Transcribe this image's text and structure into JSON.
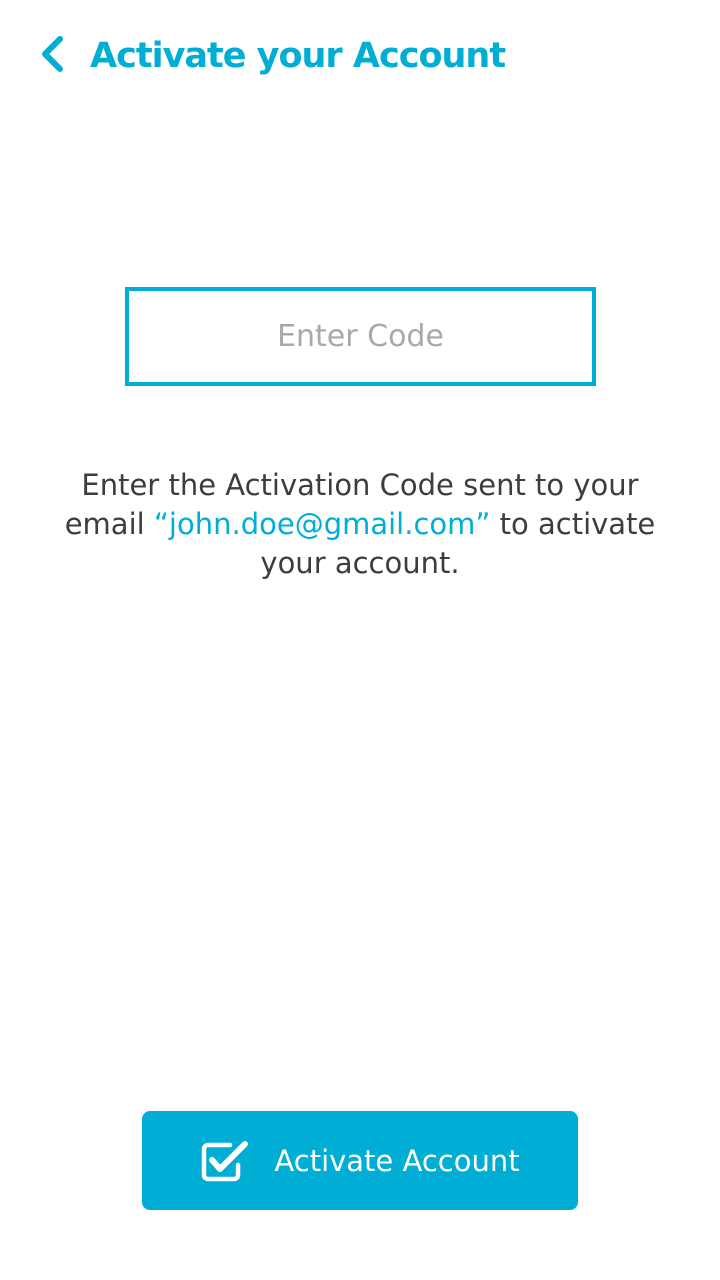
{
  "header": {
    "title": "Activate your Account",
    "back_icon": "chevron-left-icon"
  },
  "code_input": {
    "placeholder": "Enter Code",
    "value": ""
  },
  "instructions": {
    "before_email": "Enter the Activation Code sent to your email ",
    "email": "“john.doe@gmail.com”",
    "after_email": " to activate your account."
  },
  "activate_button": {
    "label": "Activate Account",
    "icon": "checkbox-checked-icon"
  },
  "colors": {
    "accent": "#00aed5",
    "text": "#3d3d3d",
    "placeholder": "#a9a9a9",
    "background": "#ffffff"
  }
}
